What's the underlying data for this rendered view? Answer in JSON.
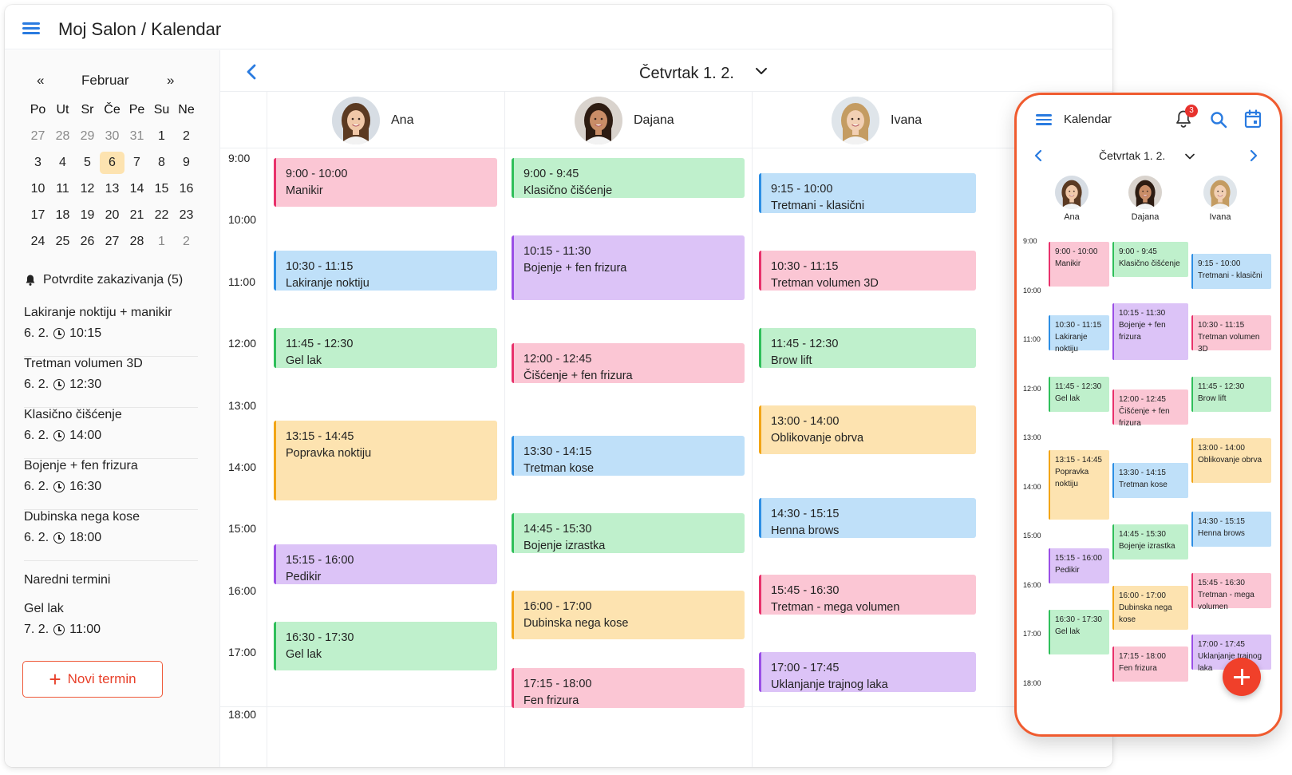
{
  "app": {
    "title": "Moj Salon / Kalendar"
  },
  "mini_calendar": {
    "prev": "«",
    "next": "»",
    "month": "Februar",
    "weekdays": [
      "Po",
      "Ut",
      "Sr",
      "Če",
      "Pe",
      "Su",
      "Ne"
    ],
    "weeks": [
      [
        "27",
        "28",
        "29",
        "30",
        "31",
        "1",
        "2"
      ],
      [
        "3",
        "4",
        "5",
        "6",
        "7",
        "8",
        "9"
      ],
      [
        "10",
        "11",
        "12",
        "13",
        "14",
        "15",
        "16"
      ],
      [
        "17",
        "18",
        "19",
        "20",
        "21",
        "22",
        "23"
      ],
      [
        "24",
        "25",
        "26",
        "27",
        "28",
        "1",
        "2"
      ]
    ],
    "selected": "6"
  },
  "pending": {
    "title": "Potvrdite zakazivanja (5)",
    "items": [
      {
        "name": "Lakiranje noktiju + manikir",
        "date": "6. 2.",
        "time": "10:15"
      },
      {
        "name": "Tretman volumen 3D",
        "date": "6. 2.",
        "time": "12:30"
      },
      {
        "name": "Klasično čišćenje",
        "date": "6. 2.",
        "time": "14:00"
      },
      {
        "name": "Bojenje + fen frizura",
        "date": "6. 2.",
        "time": "16:30"
      },
      {
        "name": "Dubinska nega kose",
        "date": "6. 2.",
        "time": "18:00"
      }
    ]
  },
  "upcoming": {
    "title": "Naredni termini",
    "items": [
      {
        "name": "Gel lak",
        "date": "7. 2.",
        "time": "11:00"
      }
    ]
  },
  "new_button": {
    "plus": "+",
    "label": "Novi termin"
  },
  "day": {
    "title": "Četvrtak 1. 2."
  },
  "times": [
    "9:00",
    "10:00",
    "11:00",
    "12:00",
    "13:00",
    "14:00",
    "15:00",
    "16:00",
    "17:00",
    "18:00"
  ],
  "staff": [
    {
      "name": "Ana",
      "appointments": [
        {
          "time": "9:00 - 10:00",
          "service": "Manikir",
          "color": "pink"
        },
        {
          "time": "10:30 - 11:15",
          "service": "Lakiranje noktiju",
          "color": "blue"
        },
        {
          "time": "11:45 - 12:30",
          "service": "Gel lak",
          "color": "green"
        },
        {
          "time": "13:15 - 14:45",
          "service": "Popravka noktiju",
          "color": "yellow"
        },
        {
          "time": "15:15 - 16:00",
          "service": "Pedikir",
          "color": "purple"
        },
        {
          "time": "16:30 - 17:30",
          "service": "Gel lak",
          "color": "green"
        }
      ]
    },
    {
      "name": "Dajana",
      "appointments": [
        {
          "time": "9:00 - 9:45",
          "service": "Klasično čišćenje",
          "color": "green"
        },
        {
          "time": "10:15 - 11:30",
          "service": "Bojenje + fen frizura",
          "color": "purple"
        },
        {
          "time": "12:00 - 12:45",
          "service": "Čišćenje + fen frizura",
          "color": "pink"
        },
        {
          "time": "13:30 - 14:15",
          "service": "Tretman kose",
          "color": "blue"
        },
        {
          "time": "14:45 - 15:30",
          "service": "Bojenje izrastka",
          "color": "green"
        },
        {
          "time": "16:00 - 17:00",
          "service": "Dubinska nega kose",
          "color": "yellow"
        },
        {
          "time": "17:15 - 18:00",
          "service": "Fen frizura",
          "color": "pink"
        }
      ]
    },
    {
      "name": "Ivana",
      "appointments": [
        {
          "time": "9:15 - 10:00",
          "service": "Tretmani - klasični",
          "color": "blue"
        },
        {
          "time": "10:30 - 11:15",
          "service": "Tretman volumen 3D",
          "color": "pink"
        },
        {
          "time": "11:45 - 12:30",
          "service": "Brow lift",
          "color": "green"
        },
        {
          "time": "13:00 - 14:00",
          "service": "Oblikovanje obrva",
          "color": "yellow"
        },
        {
          "time": "14:30 - 15:15",
          "service": "Henna brows",
          "color": "blue"
        },
        {
          "time": "15:45 - 16:30",
          "service": "Tretman - mega volumen",
          "color": "pink"
        },
        {
          "time": "17:00 - 17:45",
          "service": "Uklanjanje trajnog laka",
          "color": "purple"
        }
      ]
    }
  ],
  "phone": {
    "title": "Kalendar",
    "notifications": "3",
    "date": "Četvrtak 1. 2.",
    "appointments": [
      [
        {
          "time": "9:00 - 10:00",
          "service": "Manikir"
        },
        {
          "time": "10:30 - 11:15",
          "service": "Lakiranje noktiju"
        },
        {
          "time": "11:45 - 12:30",
          "service": "Gel lak"
        },
        {
          "time": "13:15 - 14:45",
          "service": "Popravka noktiju"
        },
        {
          "time": "15:15 - 16:00",
          "service": "Pedikir"
        },
        {
          "time": "16:30 - 17:30",
          "service": "Gel lak"
        }
      ],
      [
        {
          "time": "9:00 - 9:45",
          "service": "Klasično čišćenje"
        },
        {
          "time": "10:15 - 11:30",
          "service": "Bojenje + fen frizura"
        },
        {
          "time": "12:00 - 12:45",
          "service": "Čišćenje + fen frizura"
        },
        {
          "time": "13:30 - 14:15",
          "service": "Tretman kose"
        },
        {
          "time": "14:45 - 15:30",
          "service": "Bojenje izrastka"
        },
        {
          "time": "16:00 - 17:00",
          "service": "Dubinska nega kose"
        },
        {
          "time": "17:15 - 18:00",
          "service": "Fen frizura"
        }
      ],
      [
        {
          "time": "9:15 - 10:00",
          "service": "Tretmani - klasični"
        },
        {
          "time": "10:30 - 11:15",
          "service": "Tretman volumen 3D"
        },
        {
          "time": "11:45 - 12:30",
          "service": "Brow lift"
        },
        {
          "time": "13:00 - 14:00",
          "service": "Oblikovanje obrva"
        },
        {
          "time": "14:30 - 15:15",
          "service": "Henna brows"
        },
        {
          "time": "15:45 - 16:30",
          "service": "Tretman - mega volumen"
        },
        {
          "time": "17:00 - 17:45",
          "service": "Uklanjanje trajnog laka"
        }
      ]
    ]
  },
  "colors": {
    "pink": {
      "bg": "#fbc6d4",
      "border": "#e8316b"
    },
    "blue": {
      "bg": "#bfe0f9",
      "border": "#2c8ee4"
    },
    "green": {
      "bg": "#bff0cc",
      "border": "#2fbf5a"
    },
    "yellow": {
      "bg": "#fde3b0",
      "border": "#f2a516"
    },
    "purple": {
      "bg": "#dcc3f7",
      "border": "#9a4ee6"
    },
    "accent": "#f05b2f",
    "link": "#2a7be0"
  }
}
